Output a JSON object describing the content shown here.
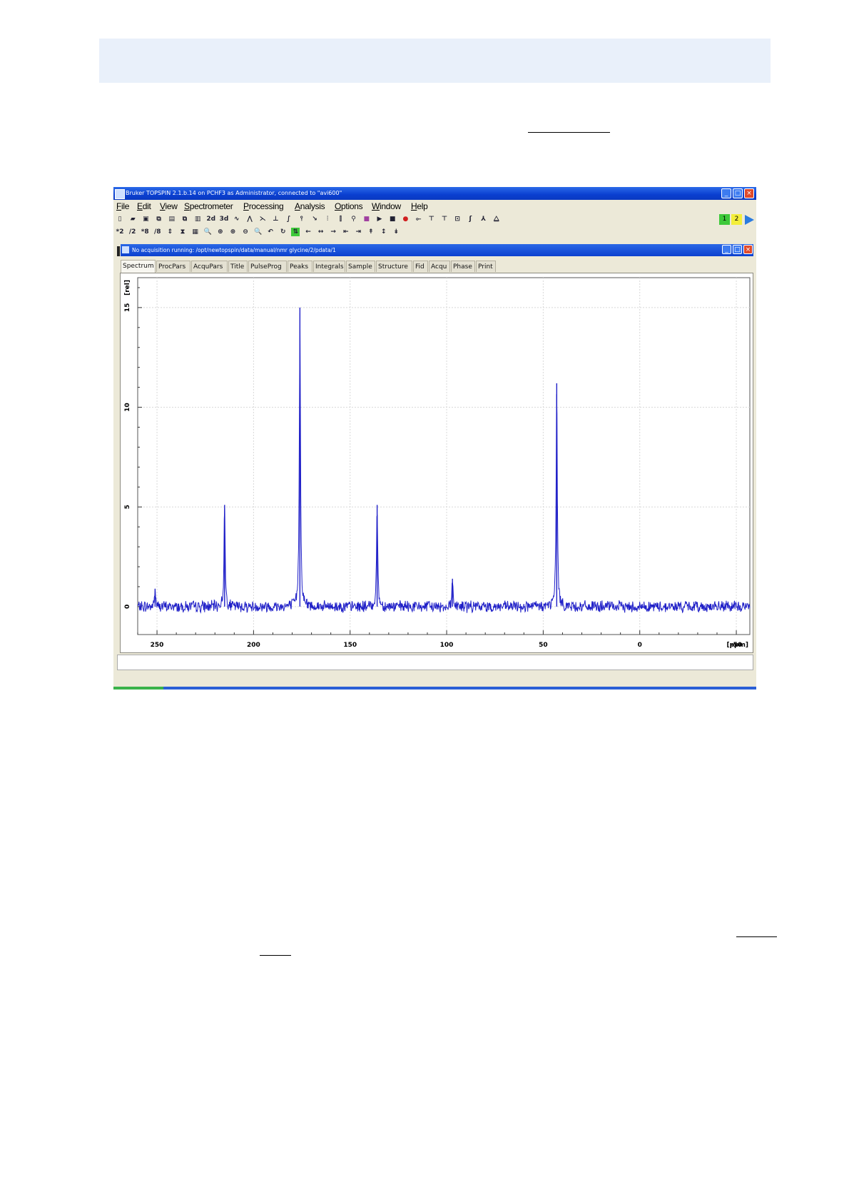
{
  "window": {
    "title": "Bruker TOPSPIN 2.1.b.14 on PCHF3 as Administrator, connected to \"avi600\"",
    "controls": [
      "minimize",
      "maximize",
      "close"
    ]
  },
  "menu": [
    "File",
    "Edit",
    "View",
    "Spectrometer",
    "Processing",
    "Analysis",
    "Options",
    "Window",
    "Help"
  ],
  "toolbar1": {
    "icons": [
      "new-icon",
      "open-icon",
      "save-icon",
      "copy-icon",
      "print-icon",
      "copy2-icon",
      "clipboard-icon",
      "2d",
      "3d",
      "fid-icon",
      "ft-icon",
      "phase-icon",
      "baseline-icon",
      "integrate-icon",
      "peakpick-icon",
      "calib-icon",
      "multi-icon",
      "display-icon",
      "sum-icon",
      "box-icon",
      "play-icon",
      "stop-icon",
      "halt-icon",
      "wobb-icon",
      "filter1-icon",
      "filter2-icon",
      "window-icon",
      "ct-icon",
      "plot-icon",
      "stack-icon"
    ],
    "indicators": [
      "1",
      "2"
    ]
  },
  "toolbar2": {
    "labels": [
      "*2",
      "/2",
      "*8",
      "/8",
      "⇕",
      "⧗",
      "▦",
      "🔍",
      "⊕",
      "⊕",
      "⊖",
      "🔍",
      "↶",
      "↻",
      "⇅",
      "←",
      "↔",
      "→",
      "⇤",
      "⇥",
      "↟",
      "↕",
      "↡"
    ]
  },
  "dataset_window": {
    "title": "No acquisition running: /opt/newtopspin/data/manual/nmr glycine/2/pdata/1"
  },
  "tabs": [
    "Spectrum",
    "ProcPars",
    "AcquPars",
    "Title",
    "PulseProg",
    "Peaks",
    "Integrals",
    "Sample",
    "Structure",
    "Fid",
    "Acqu",
    "Phase",
    "Print"
  ],
  "active_tab": "Spectrum",
  "chart_data": {
    "type": "line",
    "xlabel": "[ppm]",
    "ylabel": "[rel]",
    "xlim": [
      260,
      -57
    ],
    "ylim": [
      -1.4,
      16.5
    ],
    "xticks": [
      250,
      200,
      150,
      100,
      50,
      0,
      -50
    ],
    "xtick_labels": [
      "250",
      "200",
      "150",
      "100",
      "50",
      "0",
      "-50"
    ],
    "yticks": [
      0,
      5,
      10,
      15
    ],
    "ytick_labels": [
      "0",
      "5",
      "10",
      "15"
    ],
    "grid": true,
    "series_color": "#2020c8",
    "peaks": [
      {
        "x": 251,
        "height": 0.9
      },
      {
        "x": 215,
        "height": 5.1
      },
      {
        "x": 176,
        "height": 15.0
      },
      {
        "x": 136,
        "height": 5.1
      },
      {
        "x": 97,
        "height": 1.4
      },
      {
        "x": 43,
        "height": 11.2
      }
    ],
    "noise_amplitude": 0.25
  },
  "colors": {
    "banner": "#e9f0fa",
    "title_bar": "#0a3fd0",
    "indicator_green": "#3ec93a",
    "indicator_yellow": "#f3ee3a"
  }
}
